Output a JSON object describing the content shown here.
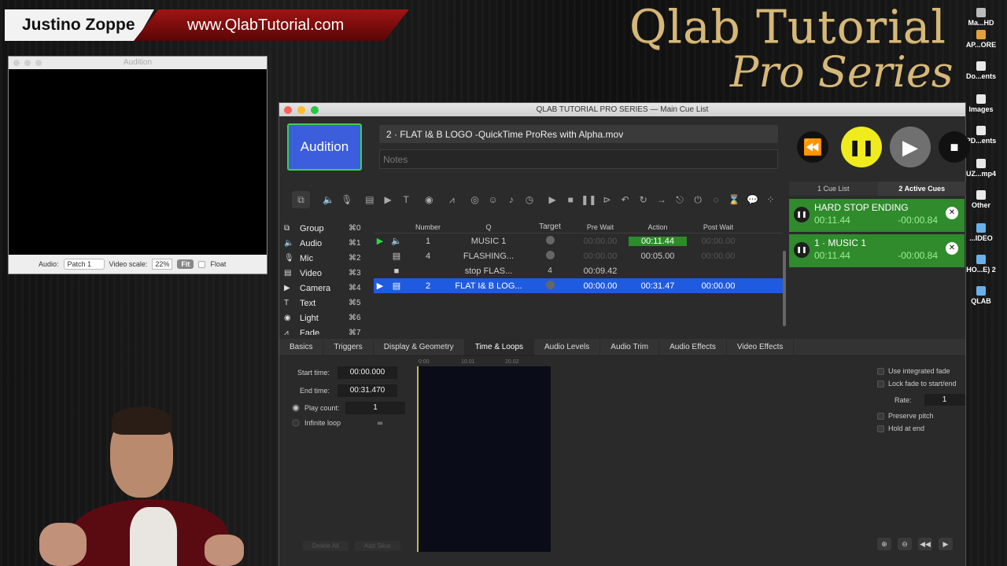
{
  "banner": {
    "name": "Justino Zoppe",
    "url": "www.QlabTutorial.com"
  },
  "logo": {
    "main": "Qlab Tutorial",
    "sub": "Pro Series"
  },
  "desktop_icons": [
    {
      "label": "Ma...HD",
      "icon": "hard-drive-icon"
    },
    {
      "label": "AP...ORE",
      "icon": "folder-icon"
    },
    {
      "label": "Do...ents",
      "icon": "document-icon"
    },
    {
      "label": "Images",
      "icon": "document-icon"
    },
    {
      "label": "PD...ents",
      "icon": "document-icon"
    },
    {
      "label": "UZ...mp4",
      "icon": "file-icon"
    },
    {
      "label": "Other",
      "icon": "file-icon"
    },
    {
      "label": "...IDEO",
      "icon": "folder-icon"
    },
    {
      "label": "HO...E) 2",
      "icon": "folder-icon"
    },
    {
      "label": "QLAB",
      "icon": "folder-icon"
    }
  ],
  "audition_window": {
    "title": "Audition",
    "audio_label": "Audio:",
    "audio_value": "Patch 1",
    "video_scale_label": "Video scale:",
    "video_scale_value": "22%",
    "fit_label": "Fit",
    "float_label": "Float"
  },
  "main_window": {
    "title": "QLAB TUTORIAL PRO SERIES — Main Cue List",
    "audition_button": "Audition",
    "cue_name": "2 · FLAT I& B LOGO -QuickTime ProRes with Alpha.mov",
    "notes_placeholder": "Notes"
  },
  "right_panel": {
    "tabs": [
      "1 Cue List",
      "2 Active Cues"
    ],
    "active_cues": [
      {
        "name": "HARD STOP ENDING",
        "elapsed": "00:11.44",
        "remaining": "-00:00.84"
      },
      {
        "name": "1 · MUSIC 1",
        "elapsed": "00:11.44",
        "remaining": "-00:00.84"
      }
    ]
  },
  "cue_types": [
    {
      "icon": "group-icon",
      "label": "Group",
      "shortcut": "⌘0"
    },
    {
      "icon": "audio-icon",
      "label": "Audio",
      "shortcut": "⌘1"
    },
    {
      "icon": "mic-icon",
      "label": "Mic",
      "shortcut": "⌘2"
    },
    {
      "icon": "video-icon",
      "label": "Video",
      "shortcut": "⌘3"
    },
    {
      "icon": "camera-icon",
      "label": "Camera",
      "shortcut": "⌘4"
    },
    {
      "icon": "text-icon",
      "label": "Text",
      "shortcut": "⌘5"
    },
    {
      "icon": "light-icon",
      "label": "Light",
      "shortcut": "⌘6"
    },
    {
      "icon": "fade-icon",
      "label": "Fade",
      "shortcut": "⌘7"
    }
  ],
  "cue_table": {
    "headers": {
      "number": "Number",
      "q": "Q",
      "target": "Target",
      "pre_wait": "Pre Wait",
      "action": "Action",
      "post_wait": "Post Wait"
    },
    "rows": [
      {
        "status": "▶",
        "type": "audio-icon",
        "number": "1",
        "q": "MUSIC 1",
        "target": "",
        "pre_wait": "00:00.00",
        "action": "00:11.44",
        "post_wait": "00:00.00"
      },
      {
        "status": "",
        "type": "video-icon",
        "number": "4",
        "q": "FLASHING...",
        "target": "",
        "pre_wait": "00:00.00",
        "action": "00:05.00",
        "post_wait": "00:00.00"
      },
      {
        "status": "",
        "type": "stop-icon",
        "number": "",
        "q": "stop FLAS...",
        "target": "4",
        "pre_wait": "00:09.42",
        "action": "",
        "post_wait": ""
      },
      {
        "status": "",
        "type": "video-icon",
        "number": "2",
        "q": "FLAT I& B LOG...",
        "target": "",
        "pre_wait": "00:00.00",
        "action": "00:31.47",
        "post_wait": "00:00.00"
      }
    ]
  },
  "inspector": {
    "tabs": [
      "Basics",
      "Triggers",
      "Display & Geometry",
      "Time & Loops",
      "Audio Levels",
      "Audio Trim",
      "Audio Effects",
      "Video Effects"
    ],
    "active_tab": "Time & Loops",
    "start_time_label": "Start time:",
    "start_time": "00:00.000",
    "end_time_label": "End time:",
    "end_time": "00:31.470",
    "play_count_label": "Play count:",
    "play_count": "1",
    "infinite_loop_label": "Infinite loop",
    "infinite_symbol": "∞",
    "ruler": [
      "0:00",
      "10.01",
      "20.02"
    ],
    "delete_all": "Delete All",
    "add_slice": "Add Slice",
    "use_integrated_fade": "Use integrated fade",
    "lock_fade": "Lock fade to start/end",
    "rate_label": "Rate:",
    "rate_value": "1",
    "preserve_pitch": "Preserve pitch",
    "hold_at_end": "Hold at end"
  }
}
